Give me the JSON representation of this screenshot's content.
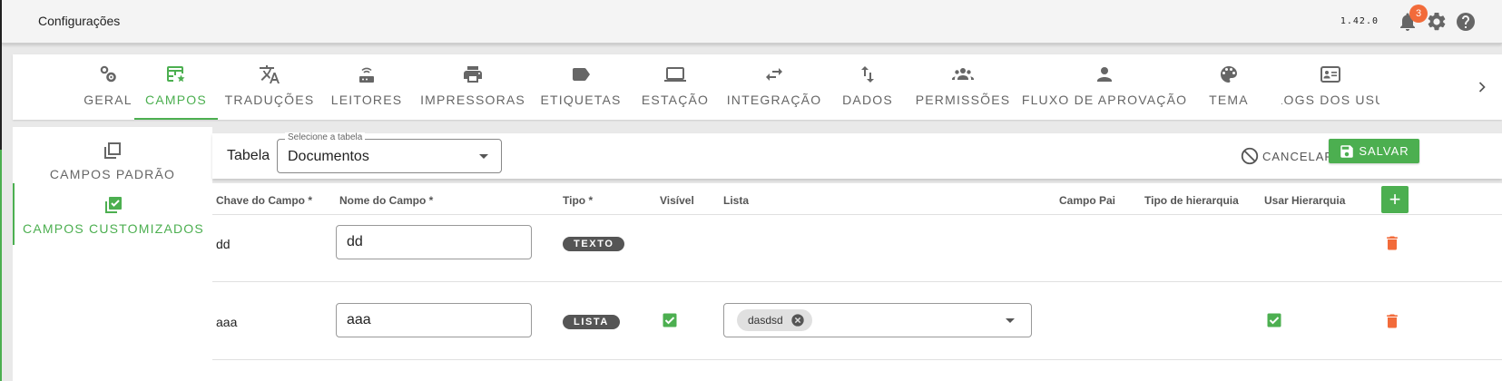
{
  "app": {
    "title": "Configurações",
    "version": "1.42.0",
    "notifications_count": "3",
    "accent_color": "#4caf50",
    "badge_color": "#f26b3a"
  },
  "tabs": [
    {
      "label": "GERAL",
      "icon": "gears-icon"
    },
    {
      "label": "CAMPOS",
      "icon": "table-edit-icon",
      "active": true
    },
    {
      "label": "TRADUÇÕES",
      "icon": "translate-icon"
    },
    {
      "label": "LEITORES",
      "icon": "router-icon"
    },
    {
      "label": "IMPRESSORAS",
      "icon": "printer-icon"
    },
    {
      "label": "ETIQUETAS",
      "icon": "label-icon"
    },
    {
      "label": "ESTAÇÃO",
      "icon": "laptop-icon"
    },
    {
      "label": "INTEGRAÇÃO",
      "icon": "swap-arrows-icon"
    },
    {
      "label": "DADOS",
      "icon": "import-export-icon"
    },
    {
      "label": "PERMISSÕES",
      "icon": "group-icon"
    },
    {
      "label": "FLUXO DE APROVAÇÃO",
      "icon": "person-icon"
    },
    {
      "label": "TEMA",
      "icon": "palette-icon"
    },
    {
      "label": "LOGS DOS USU",
      "icon": "id-card-icon"
    }
  ],
  "sidebar": {
    "items": [
      {
        "label": "CAMPOS PADRÃO",
        "icon": "copy-icon"
      },
      {
        "label": "CAMPOS CUSTOMIZADOS",
        "icon": "checkbox-multiple-icon",
        "active": true
      }
    ]
  },
  "toolbar": {
    "table_label": "Tabela",
    "select_legend": "Selecione a tabela",
    "select_value": "Documentos",
    "cancel_label": "CANCELAR",
    "save_label": "SALVAR"
  },
  "table": {
    "headers": {
      "key": "Chave do Campo *",
      "name": "Nome do Campo *",
      "type": "Tipo *",
      "visible": "Visível",
      "list": "Lista",
      "parent": "Campo Pai",
      "hierarchy_type": "Tipo de hierarquia",
      "use_hierarchy": "Usar Hierarquia"
    },
    "add_label": "+",
    "rows": [
      {
        "key": "dd",
        "name": "dd",
        "type": "TEXTO",
        "visible": false,
        "list": [],
        "use_hierarchy": false
      },
      {
        "key": "aaa",
        "name": "aaa",
        "type": "LISTA",
        "visible": true,
        "list": [
          "dasdsd"
        ],
        "use_hierarchy": true
      }
    ]
  }
}
